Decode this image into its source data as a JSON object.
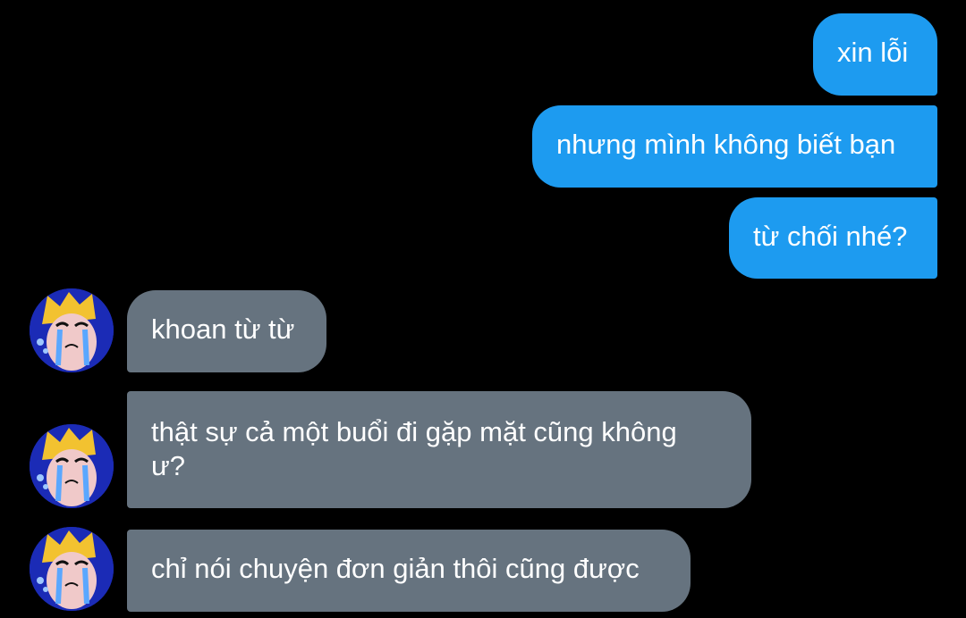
{
  "colors": {
    "background": "#000000",
    "outgoing_bubble": "#1d9bf0",
    "incoming_bubble": "#66737f",
    "text": "#ffffff"
  },
  "messages": [
    {
      "direction": "outgoing",
      "text": "xin lỗi"
    },
    {
      "direction": "outgoing",
      "text": "nhưng mình không biết bạn"
    },
    {
      "direction": "outgoing",
      "text": "từ chối nhé?"
    },
    {
      "direction": "incoming",
      "text": "khoan từ từ",
      "avatar": "crying-character-avatar"
    },
    {
      "direction": "incoming",
      "text": "thật sự cả một buổi đi gặp mặt cũng không ư?",
      "avatar": "crying-character-avatar"
    },
    {
      "direction": "incoming",
      "text": "chỉ nói chuyện đơn giản thôi cũng được",
      "avatar": "crying-character-avatar"
    }
  ]
}
